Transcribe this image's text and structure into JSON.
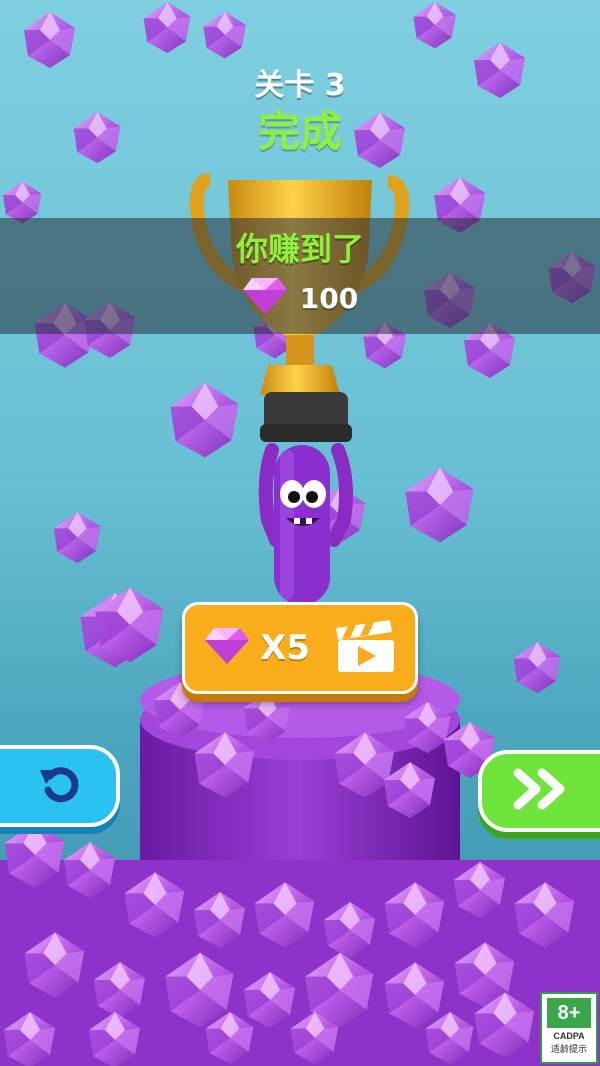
{
  "hud": {
    "level_label": "关卡 3",
    "status_label": "完成"
  },
  "reward": {
    "heading": "你赚到了",
    "gem_icon": "gem-icon",
    "amount": "100"
  },
  "buttons": {
    "multiplier_label": "X5",
    "multiplier_icons": [
      "gem-icon",
      "video-clapper-icon"
    ],
    "restart_icon": "restart-arrow-icon",
    "next_icon": "fast-forward-icon"
  },
  "age_badge": {
    "rating": "8+",
    "org": "CADPA",
    "note": "适龄提示"
  },
  "colors": {
    "accent_green": "#8ef23a",
    "gem_purple": "#b34fe0",
    "button_orange": "#f9ad1a",
    "restart_blue": "#2ac2f0",
    "next_green": "#6ee33a"
  }
}
